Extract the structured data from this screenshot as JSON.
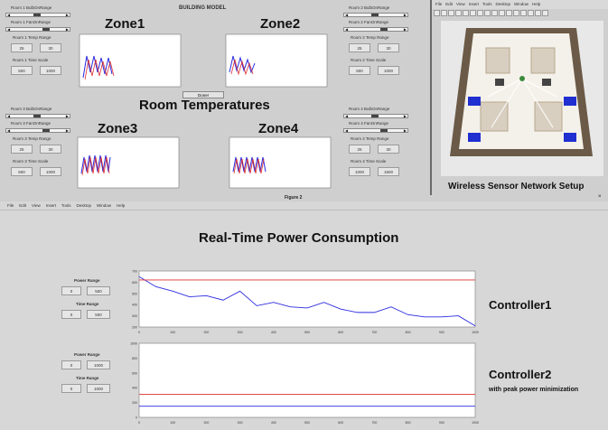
{
  "building_model": {
    "title": "BUILDING MODEL",
    "zones": [
      {
        "name": "Zone1",
        "heat_label": "Room 1 BulbOnRange",
        "fan_label": "Room 1 FanOnRange",
        "temp_label": "Room 1 Temp Range",
        "temp_min": "25",
        "temp_max": "30",
        "time_label": "Room 1 Time Scale",
        "time_min": "500",
        "time_max": "1000"
      },
      {
        "name": "Zone2",
        "heat_label": "Room 2 BulbOnRange",
        "fan_label": "Room 2 FanOnRange",
        "temp_label": "Room 2 Temp Range",
        "temp_min": "25",
        "temp_max": "30",
        "time_label": "Room 2 Time Scale",
        "time_min": "500",
        "time_max": "1000"
      },
      {
        "name": "Zone3",
        "heat_label": "Room 3 BulbOnRange",
        "fan_label": "Room 3 FanOnRange",
        "temp_label": "Room 3 Temp Range",
        "temp_min": "25",
        "temp_max": "30",
        "time_label": "Room 3 Time Scale",
        "time_min": "500",
        "time_max": "1000"
      },
      {
        "name": "Zone4",
        "heat_label": "Room 4 BulbOnRange",
        "fan_label": "Room 4 FanOnRange",
        "temp_label": "Room 4 Temp Range",
        "temp_min": "25",
        "temp_max": "30",
        "time_label": "Room 4 Time Scale",
        "time_min": "1000",
        "time_max": "1500"
      }
    ],
    "section_title": "Room Temperatures",
    "close_button": "Done!"
  },
  "wsn_window": {
    "menu": [
      "File",
      "Edit",
      "View",
      "Insert",
      "Tools",
      "Desktop",
      "Window",
      "Help"
    ],
    "caption": "Wireless Sensor Network Setup"
  },
  "figure2": {
    "title": "Figure 2",
    "menu": [
      "File",
      "Edit",
      "View",
      "Insert",
      "Tools",
      "Desktop",
      "Window",
      "Help"
    ],
    "heading": "Real-Time Power Consumption",
    "controllers": [
      {
        "name": "Controller1",
        "subtitle": "",
        "power_label": "Power Range",
        "power_min": "0",
        "power_max": "500",
        "time_label": "Time Range",
        "time_min": "0",
        "time_max": "500"
      },
      {
        "name": "Controller2",
        "subtitle": "with peak power minimization",
        "power_label": "Power Range",
        "power_min": "0",
        "power_max": "1000",
        "time_label": "Time Range",
        "time_min": "0",
        "time_max": "1000"
      }
    ]
  },
  "colors": {
    "trace_blue": "#2a2adf",
    "limit_red": "#e03030",
    "panel_bg": "#cfcfcf"
  },
  "chart_data": [
    {
      "type": "line",
      "x": [
        0,
        50,
        100,
        150,
        200,
        250,
        300,
        350,
        400,
        450,
        500,
        550,
        600,
        650,
        700,
        750,
        800,
        850,
        900,
        950,
        1000
      ],
      "series": [
        {
          "values": [
            650,
            560,
            520,
            470,
            480,
            440,
            520,
            390,
            420,
            380,
            370,
            420,
            360,
            330,
            330,
            380,
            310,
            290,
            290,
            300,
            210
          ]
        },
        {
          "values": [
            620,
            620,
            620,
            620,
            620,
            620,
            620,
            620,
            620,
            620,
            620,
            620,
            620,
            620,
            620,
            620,
            620,
            620,
            620,
            620,
            620
          ]
        }
      ],
      "xlim": [
        0,
        1000
      ],
      "ylim": [
        200,
        700
      ],
      "xticks": [
        "0",
        "100",
        "200",
        "300",
        "400",
        "500",
        "600",
        "700",
        "800",
        "900",
        "1000"
      ],
      "yticks": [
        "700",
        "600",
        "500",
        "400",
        "300",
        "200"
      ]
    },
    {
      "type": "line",
      "x": [
        0,
        50,
        100,
        150,
        200,
        250,
        300,
        350,
        400,
        450,
        500,
        550,
        600,
        650,
        700,
        750,
        800,
        850,
        900,
        950,
        1000
      ],
      "series": [
        {
          "values": [
            150,
            150,
            150,
            150,
            150,
            150,
            150,
            150,
            150,
            150,
            150,
            150,
            150,
            150,
            150,
            150,
            150,
            150,
            150,
            150,
            150
          ]
        },
        {
          "values": [
            310,
            310,
            310,
            310,
            310,
            310,
            310,
            310,
            310,
            310,
            310,
            310,
            310,
            310,
            310,
            310,
            310,
            310,
            310,
            310,
            310
          ]
        }
      ],
      "xlim": [
        0,
        1000
      ],
      "ylim": [
        0,
        1000
      ],
      "xticks": [
        "0",
        "100",
        "200",
        "300",
        "400",
        "500",
        "600",
        "700",
        "800",
        "900",
        "1000"
      ],
      "yticks": [
        "1000",
        "800",
        "600",
        "400",
        "200",
        "0"
      ]
    }
  ]
}
